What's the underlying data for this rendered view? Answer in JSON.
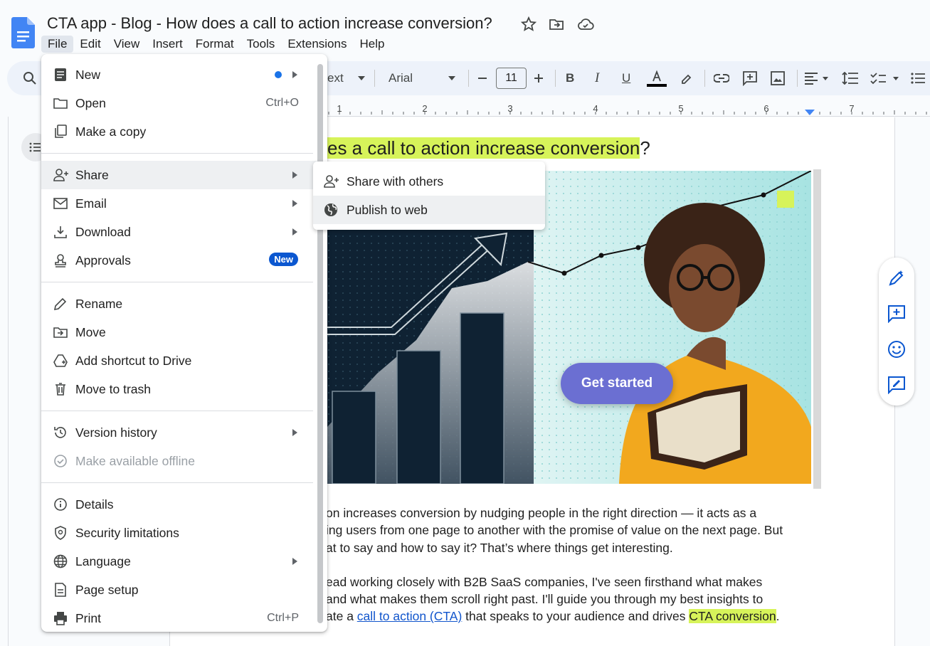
{
  "app": {
    "title": "CTA app - Blog - How does a call to action increase conversion?"
  },
  "menubar": [
    "File",
    "Edit",
    "View",
    "Insert",
    "Format",
    "Tools",
    "Extensions",
    "Help"
  ],
  "toolbar": {
    "style_label": "ext",
    "font": "Arial",
    "font_size": "11",
    "ruler_numbers": [
      "1",
      "2",
      "3",
      "4",
      "5",
      "6",
      "7"
    ]
  },
  "document": {
    "heading_hidden_part": "es a call to action increase conversion",
    "heading_tail": "?",
    "image": {
      "cta_button": "Get started"
    },
    "paragraph1": [
      "on increases conversion by nudging people in the right direction — it acts as a",
      "ing users from one page to another with the promise of value on the next page. But",
      "at to say and how to say it? That’s where things get interesting."
    ],
    "paragraph2": [
      "ead working closely with B2B SaaS companies, I've seen firsthand what makes",
      "and what makes them scroll right past. I'll guide you through my best insights to"
    ],
    "paragraph2_last": {
      "prefix": "ate a ",
      "link": "call to action (CTA)",
      "middle": " that speaks to your audience and drives ",
      "highlight": "CTA conversion",
      "suffix": "."
    }
  },
  "file_menu": {
    "items": [
      {
        "label": "New",
        "icon": "doc-icon",
        "submenu": true,
        "dot": true
      },
      {
        "label": "Open",
        "icon": "folder-icon",
        "shortcut": "Ctrl+O"
      },
      {
        "label": "Make a copy",
        "icon": "copy-icon"
      },
      {
        "label": "Share",
        "icon": "person-add-icon",
        "submenu": true
      },
      {
        "label": "Email",
        "icon": "mail-icon",
        "submenu": true
      },
      {
        "label": "Download",
        "icon": "download-icon",
        "submenu": true
      },
      {
        "label": "Approvals",
        "icon": "approvals-icon",
        "badge": "New"
      },
      {
        "label": "Rename",
        "icon": "pencil-icon"
      },
      {
        "label": "Move",
        "icon": "move-folder-icon"
      },
      {
        "label": "Add shortcut to Drive",
        "icon": "drive-shortcut-icon"
      },
      {
        "label": "Move to trash",
        "icon": "trash-icon"
      },
      {
        "label": "Version history",
        "icon": "history-icon",
        "submenu": true
      },
      {
        "label": "Make available offline",
        "icon": "offline-icon",
        "disabled": true
      },
      {
        "label": "Details",
        "icon": "info-icon"
      },
      {
        "label": "Security limitations",
        "icon": "shield-icon"
      },
      {
        "label": "Language",
        "icon": "globe-icon",
        "submenu": true
      },
      {
        "label": "Page setup",
        "icon": "page-icon"
      },
      {
        "label": "Print",
        "icon": "printer-icon",
        "shortcut": "Ctrl+P"
      }
    ]
  },
  "share_submenu": {
    "items": [
      {
        "label": "Share with others",
        "icon": "person-add-icon"
      },
      {
        "label": "Publish to web",
        "icon": "globe-icon"
      }
    ]
  },
  "colors": {
    "highlight": "#d7f35a",
    "accent_blue": "#0b57d0",
    "link": "#1155cc"
  }
}
